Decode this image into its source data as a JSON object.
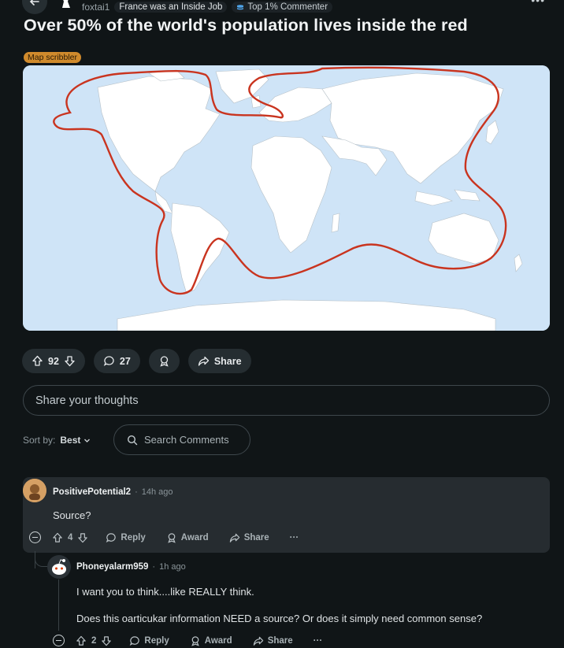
{
  "header": {
    "username": "foxtai1",
    "user_flair": "France was an Inside Job",
    "badge": "Top 1% Commenter"
  },
  "post": {
    "title": "Over 50% of the world's population lives inside the red",
    "flair": "Map scribbler",
    "upvotes": "92",
    "comments": "27",
    "share_label": "Share"
  },
  "composer": {
    "placeholder": "Share your thoughts"
  },
  "sort": {
    "label": "Sort by:",
    "value": "Best"
  },
  "search": {
    "placeholder": "Search Comments"
  },
  "comments": [
    {
      "user": "PositivePotential2",
      "time": "14h ago",
      "body": "Source?",
      "votes": "4",
      "reply": "Reply",
      "award": "Award",
      "share": "Share",
      "more": "···"
    },
    {
      "user": "Phoneyalarm959",
      "time": "1h ago",
      "body_line1": "I want you to think....like REALLY think.",
      "body_line2": "Does this oarticukar information NEED a source? Or does it simply need common sense?",
      "votes": "2",
      "reply": "Reply",
      "award": "Award",
      "share": "Share",
      "more": "···"
    }
  ],
  "colors": {
    "accent_red": "#c9341f",
    "ocean": "#cfe4f7",
    "flair": "#d08a2c"
  }
}
